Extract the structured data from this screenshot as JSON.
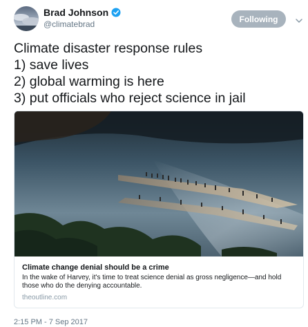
{
  "author": {
    "display_name": "Brad Johnson",
    "handle": "@climatebrad",
    "verified_icon": "verified-badge-icon"
  },
  "follow_button": {
    "label": "Following"
  },
  "tweet": {
    "lines": [
      "Climate disaster response rules",
      "1) save lives",
      "2) global warming is here",
      "3) put officials who reject science in jail"
    ]
  },
  "card": {
    "title": "Climate change denial should be a crime",
    "description": "In the wake of Harvey, it's time to treat science denial as gross negligence—and hold those who do the denying accountable.",
    "domain": "theoutline.com"
  },
  "timestamp": "2:15 PM - 7 Sep 2017",
  "colors": {
    "verified": "#1da1f2",
    "following_button": "#a8b3bd",
    "secondary_text": "#657786"
  }
}
